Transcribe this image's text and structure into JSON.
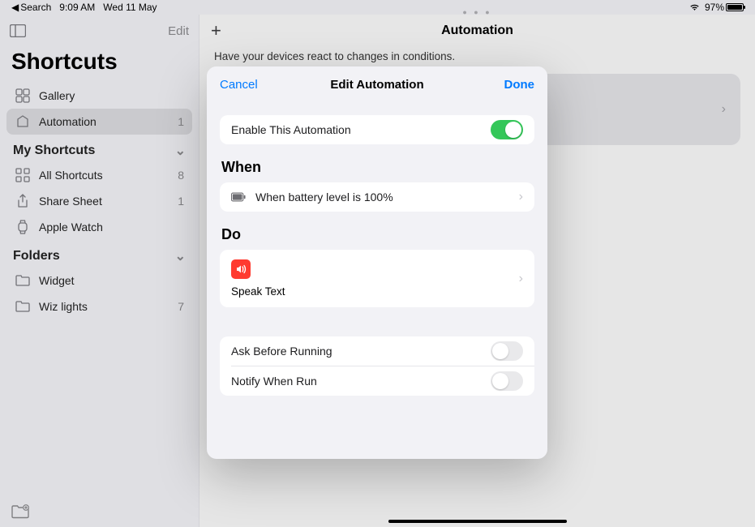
{
  "statusbar": {
    "back_label": "Search",
    "time": "9:09 AM",
    "date": "Wed 11 May",
    "battery_pct": "97%"
  },
  "sidebar": {
    "edit": "Edit",
    "title": "Shortcuts",
    "gallery": "Gallery",
    "automation": "Automation",
    "automation_count": "1",
    "my_shortcuts": "My Shortcuts",
    "all_shortcuts": "All Shortcuts",
    "all_shortcuts_count": "8",
    "share_sheet": "Share Sheet",
    "share_sheet_count": "1",
    "apple_watch": "Apple Watch",
    "folders": "Folders",
    "widget": "Widget",
    "wiz": "Wiz lights",
    "wiz_count": "7"
  },
  "main": {
    "title": "Automation",
    "subtitle": "Have your devices react to changes in conditions."
  },
  "modal": {
    "cancel": "Cancel",
    "title": "Edit Automation",
    "done": "Done",
    "enable_label": "Enable This Automation",
    "when_header": "When",
    "when_desc": "When battery level is 100%",
    "do_header": "Do",
    "do_action": "Speak Text",
    "ask_before": "Ask Before Running",
    "notify": "Notify When Run"
  }
}
